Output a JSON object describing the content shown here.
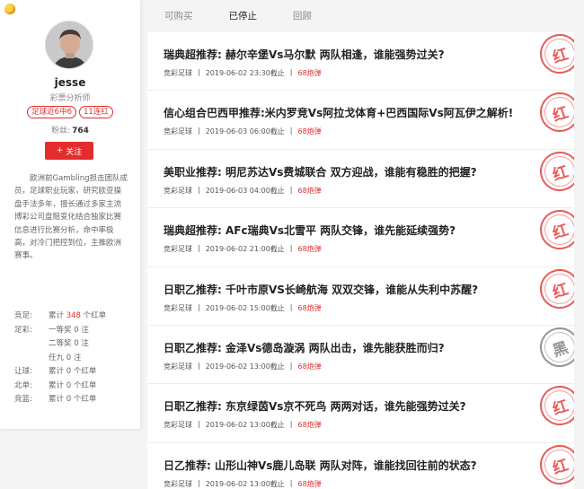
{
  "profile": {
    "name": "jesse",
    "role": "彩票分析师",
    "tags": [
      "足球近6中6",
      "11连红"
    ],
    "fans_label": "粉丝:",
    "fans_count": "764",
    "follow_label": "关注",
    "bio": "欧洲前Gambling担击团队成员，足球职业玩家，研究欧亚操盘手法多年，擅长通过多家主流博彩公司盘赔变化结合独家比赛信息进行比赛分析，命中率极高，对冷门把控到位，主推欧洲赛事。"
  },
  "stats": [
    {
      "label": "竞足:",
      "prefix": "累计",
      "value": "348",
      "suffix": "个红单"
    },
    {
      "label": "足彩:",
      "prefix": "一等奖",
      "value": "0",
      "suffix": "注"
    },
    {
      "label": "",
      "prefix": "二等奖",
      "value": "0",
      "suffix": "注"
    },
    {
      "label": "",
      "prefix": "任九",
      "value": "0",
      "suffix": "注"
    },
    {
      "label": "让球:",
      "prefix": "累计",
      "value": "0",
      "suffix": "个红单"
    },
    {
      "label": "北单:",
      "prefix": "累计",
      "value": "0",
      "suffix": "个红单"
    },
    {
      "label": "竞篮:",
      "prefix": "累计",
      "value": "0",
      "suffix": "个红单"
    }
  ],
  "tabs": [
    {
      "label": "可购买",
      "active": false
    },
    {
      "label": "已停止",
      "active": true
    },
    {
      "label": "回顾",
      "active": false
    }
  ],
  "items": [
    {
      "title": "瑞典超推荐: 赫尔辛堡Vs马尔默 两队相逢，谁能强势过关?",
      "category": "竞彩足球",
      "time": "2019-06-02 23:30截止",
      "price": "68炮弹",
      "result": "红"
    },
    {
      "title": "信心组合巴西甲推荐:米内罗竞Vs阿拉戈体育+巴西国际Vs阿瓦伊之解析!",
      "category": "竞彩足球",
      "time": "2019-06-03 06:00截止",
      "price": "68炮弹",
      "result": "红"
    },
    {
      "title": "美职业推荐: 明尼苏达Vs费城联合 双方迎战，谁能有稳胜的把握?",
      "category": "竞彩足球",
      "time": "2019-06-03 04:00截止",
      "price": "68炮弹",
      "result": "红"
    },
    {
      "title": "瑞典超推荐: AFc瑞典Vs北雪平 两队交锋，谁先能延续强势?",
      "category": "竞彩足球",
      "time": "2019-06-02 21:00截止",
      "price": "68炮弹",
      "result": "红"
    },
    {
      "title": "日职乙推荐: 千叶市原VS长崎航海 双双交锋，谁能从失利中苏醒?",
      "category": "竞彩足球",
      "time": "2019-06-02 15:00截止",
      "price": "68炮弹",
      "result": "红"
    },
    {
      "title": "日职乙推荐: 金泽Vs德岛漩涡 两队出击，谁先能获胜而归?",
      "category": "竞彩足球",
      "time": "2019-06-02 13:00截止",
      "price": "68炮弹",
      "result": "黑"
    },
    {
      "title": "日职乙推荐: 东京绿茵Vs京不死鸟 两两对话，谁先能强势过关?",
      "category": "竞彩足球",
      "time": "2019-06-02 13:00截止",
      "price": "68炮弹",
      "result": "红"
    },
    {
      "title": "日乙推荐: 山形山神Vs鹿儿岛联 两队对阵，谁能找回往前的状态?",
      "category": "竞彩足球",
      "time": "2019-06-02 13:00截止",
      "price": "68炮弹",
      "result": "红"
    }
  ],
  "colors": {
    "accent": "#e32d2d",
    "stamp_red": "#e84a4a",
    "stamp_black": "#8a8a8a"
  }
}
